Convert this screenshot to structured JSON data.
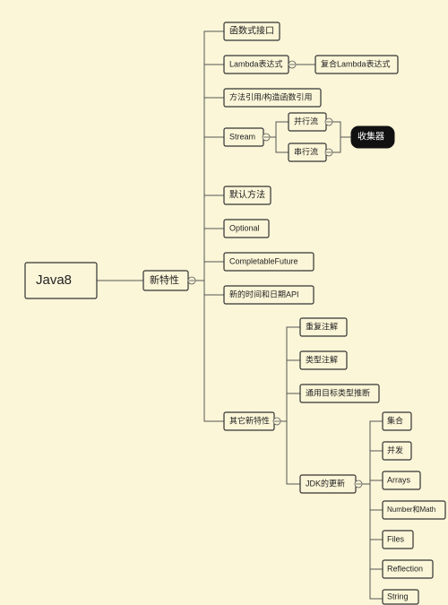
{
  "root": {
    "label": "Java8"
  },
  "l1": {
    "label": "新特性"
  },
  "l2": [
    {
      "id": "fi",
      "label": "函数式接口"
    },
    {
      "id": "lam",
      "label": "Lambda表达式"
    },
    {
      "id": "mref",
      "label": "方法引用/构造函数引用"
    },
    {
      "id": "str",
      "label": "Stream"
    },
    {
      "id": "def",
      "label": "默认方法"
    },
    {
      "id": "opt",
      "label": "Optional"
    },
    {
      "id": "cf",
      "label": "CompletableFuture"
    },
    {
      "id": "date",
      "label": "新的时间和日期API"
    },
    {
      "id": "oth",
      "label": "其它新特性"
    }
  ],
  "lambda_child": {
    "label": "复合Lambda表达式"
  },
  "stream_children": [
    {
      "id": "par",
      "label": "并行流"
    },
    {
      "id": "seq",
      "label": "串行流"
    }
  ],
  "collector": {
    "label": "收集器"
  },
  "other_children": [
    {
      "id": "rep",
      "label": "重复注解"
    },
    {
      "id": "typ",
      "label": "类型注解"
    },
    {
      "id": "gen",
      "label": "通用目标类型推断"
    },
    {
      "id": "jdk",
      "label": "JDK的更新"
    }
  ],
  "jdk_children": [
    {
      "id": "col",
      "label": "集合"
    },
    {
      "id": "conc",
      "label": "并发"
    },
    {
      "id": "arr",
      "label": "Arrays"
    },
    {
      "id": "num",
      "label": "Number和Math"
    },
    {
      "id": "fil",
      "label": "Files"
    },
    {
      "id": "ref",
      "label": "Reflection"
    },
    {
      "id": "stg",
      "label": "String"
    }
  ]
}
